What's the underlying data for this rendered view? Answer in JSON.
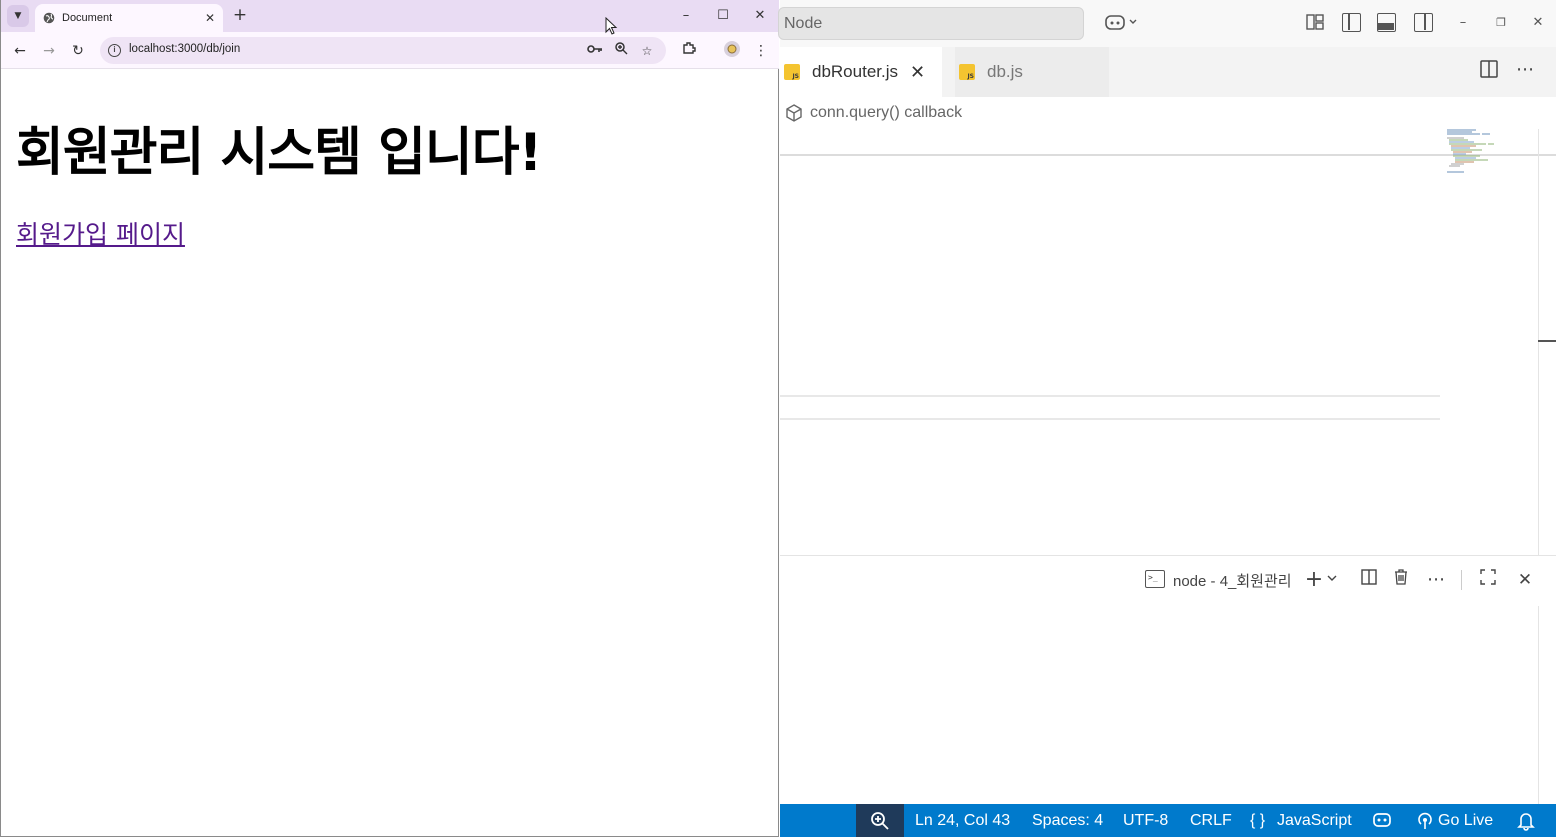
{
  "browser": {
    "tab_title": "Document",
    "tab_close": "✕",
    "new_tab": "+",
    "window": {
      "minimize": "–",
      "maximize": "☐",
      "close": "✕"
    },
    "nav": {
      "back": "←",
      "forward": "→",
      "reload": "↻"
    },
    "url": "localhost:3000/db/join",
    "page": {
      "heading": "회원관리 시스템 입니다!",
      "link_text": "회원가입 페이지"
    }
  },
  "vscode": {
    "search_text": "Node",
    "window": {
      "minimize": "–",
      "restore": "❐",
      "close": "✕"
    },
    "tabs": [
      {
        "label": "dbRouter.js",
        "active": true,
        "close": "✕"
      },
      {
        "label": "db.js",
        "active": false
      }
    ],
    "breadcrumb": "conn.query() callback",
    "terminal": {
      "label": "node - 4_회원관리"
    },
    "statusbar": {
      "position": "Ln 24, Col 43",
      "spaces": "Spaces: 4",
      "encoding": "UTF-8",
      "eol": "CRLF",
      "language_braces": "{ }",
      "language": "JavaScript",
      "go_live": "Go Live"
    }
  },
  "colors": {
    "browser_tabbar": "#e9dcf3",
    "link_visited": "#551a8b",
    "statusbar": "#007acc",
    "js_icon": "#f4c430"
  }
}
